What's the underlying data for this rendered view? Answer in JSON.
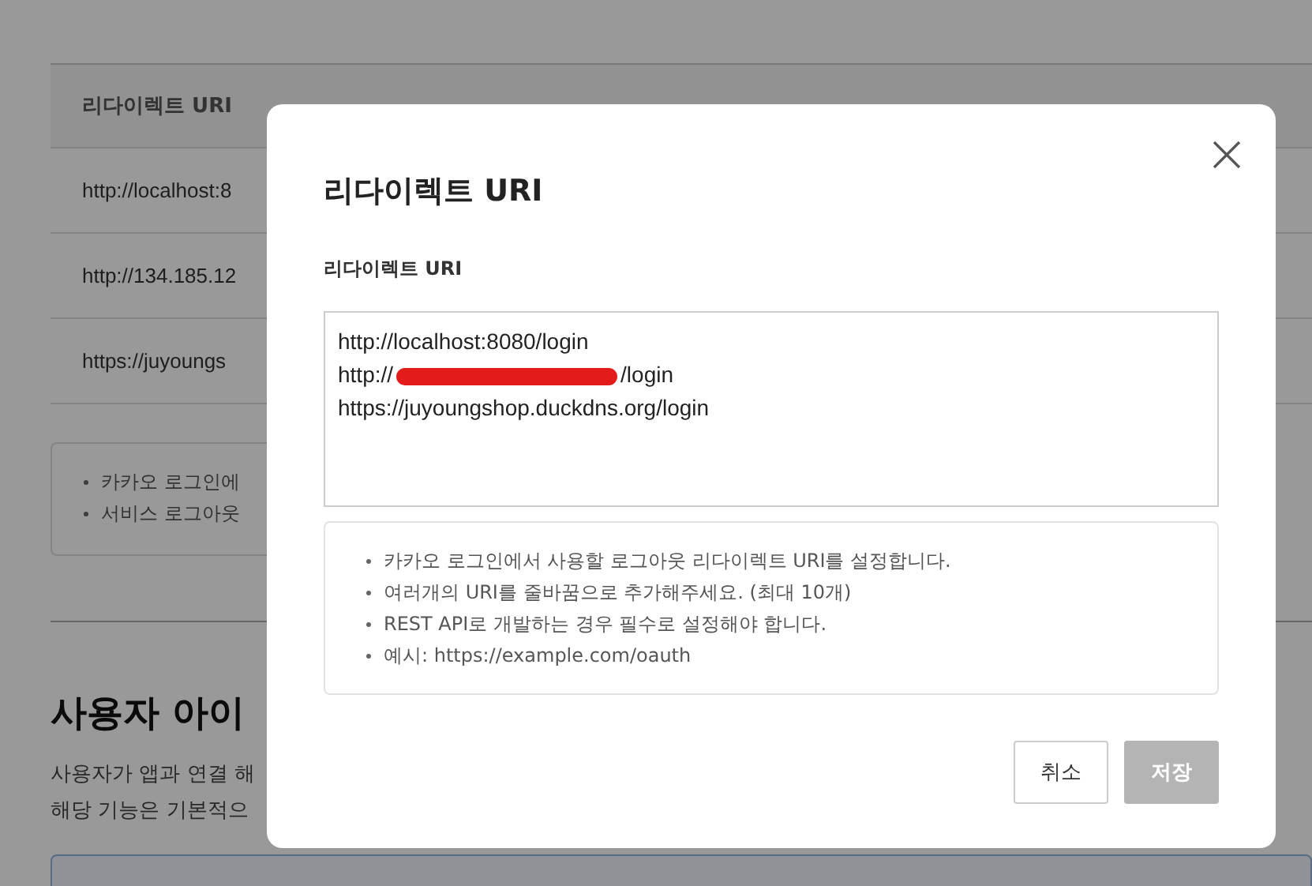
{
  "background": {
    "table": {
      "columns": [
        "리다이렉트 URI"
      ],
      "rows": [
        "http://localhost:8",
        "http://134.185.12",
        "https://juyoungs"
      ]
    },
    "notes": [
      "카카오 로그인에",
      "서비스 로그아웃"
    ],
    "section": {
      "title": "사용자 아이",
      "lines": [
        "사용자가 앱과 연결 해",
        "해당 기능은 기본적으"
      ]
    }
  },
  "dialog": {
    "title": "리다이렉트 URI",
    "field_label": "리다이렉트 URI",
    "field_lines": [
      {
        "text": "http://localhost:8080/login",
        "redacted": false
      },
      {
        "text": "http://",
        "redacted": true,
        "after": "/login"
      },
      {
        "text": "https://juyoungshop.duckdns.org/login",
        "redacted": false
      }
    ],
    "help": [
      "카카오 로그인에서 사용할 로그아웃 리다이렉트 URI를 설정합니다.",
      "여러개의 URI를 줄바꿈으로 추가해주세요. (최대 10개)",
      "REST API로 개발하는 경우 필수로 설정해야 합니다.",
      "예시: https://example.com/oauth"
    ],
    "buttons": [
      {
        "label": "취소",
        "kind": "secondary",
        "disabled": false
      },
      {
        "label": "저장",
        "kind": "primary",
        "disabled": true
      }
    ]
  }
}
